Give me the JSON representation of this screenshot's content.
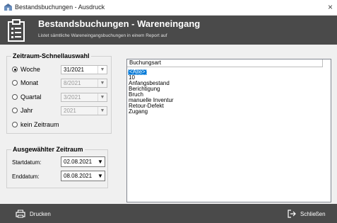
{
  "window": {
    "title": "Bestandsbuchungen - Ausdruck",
    "close_glyph": "×"
  },
  "header": {
    "title": "Bestandsbuchungen - Wareneingang",
    "subtitle": "Listet sämtliche Wareneingangsbuchungen in einem Report auf",
    "icon": "clipboard-list-icon"
  },
  "quick_select": {
    "legend": "Zeitraum-Schnellauswahl",
    "options": [
      {
        "label": "Woche",
        "checked": true,
        "value": "31/2021",
        "enabled": true
      },
      {
        "label": "Monat",
        "checked": false,
        "value": "8/2021",
        "enabled": false
      },
      {
        "label": "Quartal",
        "checked": false,
        "value": "3/2021",
        "enabled": false
      },
      {
        "label": "Jahr",
        "checked": false,
        "value": "2021",
        "enabled": false
      },
      {
        "label": "kein Zeitraum",
        "checked": false
      }
    ]
  },
  "selected_range": {
    "legend": "Ausgewählter Zeitraum",
    "start_label": "Startdatum:",
    "start_value": "02.08.2021",
    "end_label": "Enddatum:",
    "end_value": "08.08.2021"
  },
  "booking_types": {
    "header": "Buchungsart",
    "items": [
      "<Alle>",
      "10",
      "Anfangsbestand",
      "Berichtigung",
      "Bruch",
      "manuelle Inventur",
      "Retour-Defekt",
      "Zugang"
    ],
    "selected_index": 0
  },
  "footer": {
    "print_label": "Drucken",
    "close_label": "Schließen"
  },
  "colors": {
    "header_bg": "#4a4a4a",
    "selection": "#0078d7",
    "background": "#f0f0f0"
  }
}
